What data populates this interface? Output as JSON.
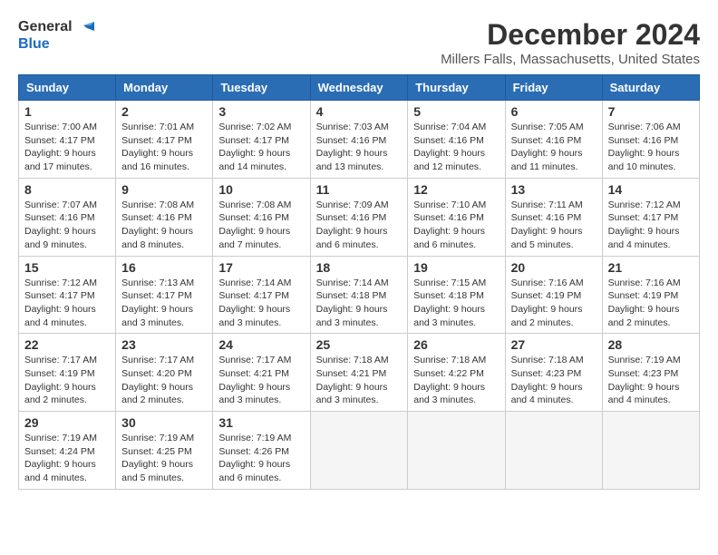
{
  "logo": {
    "line1": "General",
    "line2": "Blue"
  },
  "title": "December 2024",
  "subtitle": "Millers Falls, Massachusetts, United States",
  "headers": [
    "Sunday",
    "Monday",
    "Tuesday",
    "Wednesday",
    "Thursday",
    "Friday",
    "Saturday"
  ],
  "weeks": [
    [
      {
        "day": "1",
        "sunrise": "7:00 AM",
        "sunset": "4:17 PM",
        "daylight": "9 hours and 17 minutes."
      },
      {
        "day": "2",
        "sunrise": "7:01 AM",
        "sunset": "4:17 PM",
        "daylight": "9 hours and 16 minutes."
      },
      {
        "day": "3",
        "sunrise": "7:02 AM",
        "sunset": "4:17 PM",
        "daylight": "9 hours and 14 minutes."
      },
      {
        "day": "4",
        "sunrise": "7:03 AM",
        "sunset": "4:16 PM",
        "daylight": "9 hours and 13 minutes."
      },
      {
        "day": "5",
        "sunrise": "7:04 AM",
        "sunset": "4:16 PM",
        "daylight": "9 hours and 12 minutes."
      },
      {
        "day": "6",
        "sunrise": "7:05 AM",
        "sunset": "4:16 PM",
        "daylight": "9 hours and 11 minutes."
      },
      {
        "day": "7",
        "sunrise": "7:06 AM",
        "sunset": "4:16 PM",
        "daylight": "9 hours and 10 minutes."
      }
    ],
    [
      {
        "day": "8",
        "sunrise": "7:07 AM",
        "sunset": "4:16 PM",
        "daylight": "9 hours and 9 minutes."
      },
      {
        "day": "9",
        "sunrise": "7:08 AM",
        "sunset": "4:16 PM",
        "daylight": "9 hours and 8 minutes."
      },
      {
        "day": "10",
        "sunrise": "7:08 AM",
        "sunset": "4:16 PM",
        "daylight": "9 hours and 7 minutes."
      },
      {
        "day": "11",
        "sunrise": "7:09 AM",
        "sunset": "4:16 PM",
        "daylight": "9 hours and 6 minutes."
      },
      {
        "day": "12",
        "sunrise": "7:10 AM",
        "sunset": "4:16 PM",
        "daylight": "9 hours and 6 minutes."
      },
      {
        "day": "13",
        "sunrise": "7:11 AM",
        "sunset": "4:16 PM",
        "daylight": "9 hours and 5 minutes."
      },
      {
        "day": "14",
        "sunrise": "7:12 AM",
        "sunset": "4:17 PM",
        "daylight": "9 hours and 4 minutes."
      }
    ],
    [
      {
        "day": "15",
        "sunrise": "7:12 AM",
        "sunset": "4:17 PM",
        "daylight": "9 hours and 4 minutes."
      },
      {
        "day": "16",
        "sunrise": "7:13 AM",
        "sunset": "4:17 PM",
        "daylight": "9 hours and 3 minutes."
      },
      {
        "day": "17",
        "sunrise": "7:14 AM",
        "sunset": "4:17 PM",
        "daylight": "9 hours and 3 minutes."
      },
      {
        "day": "18",
        "sunrise": "7:14 AM",
        "sunset": "4:18 PM",
        "daylight": "9 hours and 3 minutes."
      },
      {
        "day": "19",
        "sunrise": "7:15 AM",
        "sunset": "4:18 PM",
        "daylight": "9 hours and 3 minutes."
      },
      {
        "day": "20",
        "sunrise": "7:16 AM",
        "sunset": "4:19 PM",
        "daylight": "9 hours and 2 minutes."
      },
      {
        "day": "21",
        "sunrise": "7:16 AM",
        "sunset": "4:19 PM",
        "daylight": "9 hours and 2 minutes."
      }
    ],
    [
      {
        "day": "22",
        "sunrise": "7:17 AM",
        "sunset": "4:19 PM",
        "daylight": "9 hours and 2 minutes."
      },
      {
        "day": "23",
        "sunrise": "7:17 AM",
        "sunset": "4:20 PM",
        "daylight": "9 hours and 2 minutes."
      },
      {
        "day": "24",
        "sunrise": "7:17 AM",
        "sunset": "4:21 PM",
        "daylight": "9 hours and 3 minutes."
      },
      {
        "day": "25",
        "sunrise": "7:18 AM",
        "sunset": "4:21 PM",
        "daylight": "9 hours and 3 minutes."
      },
      {
        "day": "26",
        "sunrise": "7:18 AM",
        "sunset": "4:22 PM",
        "daylight": "9 hours and 3 minutes."
      },
      {
        "day": "27",
        "sunrise": "7:18 AM",
        "sunset": "4:23 PM",
        "daylight": "9 hours and 4 minutes."
      },
      {
        "day": "28",
        "sunrise": "7:19 AM",
        "sunset": "4:23 PM",
        "daylight": "9 hours and 4 minutes."
      }
    ],
    [
      {
        "day": "29",
        "sunrise": "7:19 AM",
        "sunset": "4:24 PM",
        "daylight": "9 hours and 4 minutes."
      },
      {
        "day": "30",
        "sunrise": "7:19 AM",
        "sunset": "4:25 PM",
        "daylight": "9 hours and 5 minutes."
      },
      {
        "day": "31",
        "sunrise": "7:19 AM",
        "sunset": "4:26 PM",
        "daylight": "9 hours and 6 minutes."
      },
      null,
      null,
      null,
      null
    ]
  ],
  "labels": {
    "sunrise": "Sunrise:",
    "sunset": "Sunset:",
    "daylight": "Daylight:"
  }
}
